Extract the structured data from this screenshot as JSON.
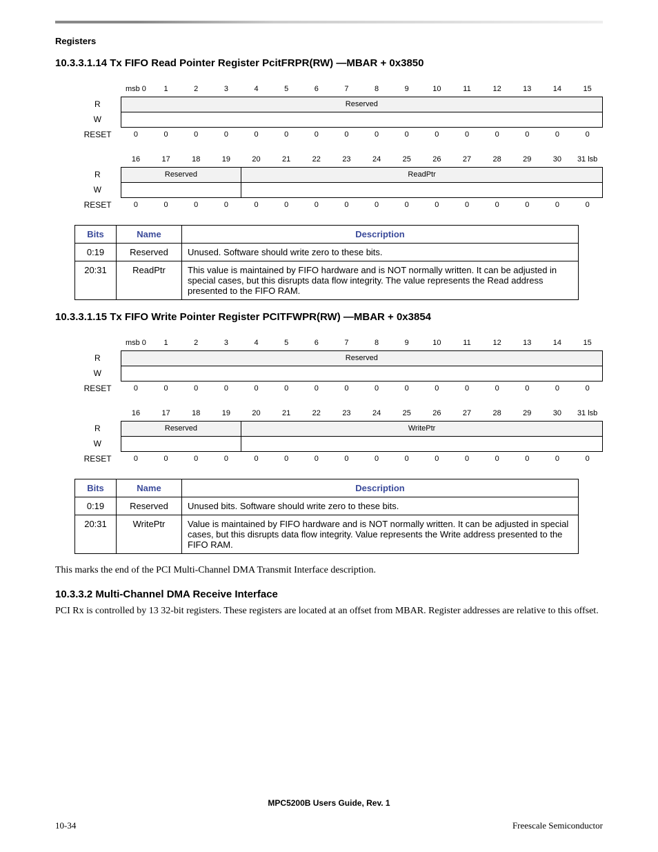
{
  "header_label": "Registers",
  "sec1": {
    "title": "10.3.3.1.14  Tx FIFO Read Pointer Register PcitFRPR(RW) —MBAR + 0x3850",
    "bits_hi": [
      "msb 0",
      "1",
      "2",
      "3",
      "4",
      "5",
      "6",
      "7",
      "8",
      "9",
      "10",
      "11",
      "12",
      "13",
      "14",
      "15"
    ],
    "bits_lo": [
      "16",
      "17",
      "18",
      "19",
      "20",
      "21",
      "22",
      "23",
      "24",
      "25",
      "26",
      "27",
      "28",
      "29",
      "30",
      "31 lsb"
    ],
    "rw_r": "R",
    "rw_w": "W",
    "rw_reset": "RESET",
    "row1_field": "Reserved",
    "row1_reset": [
      "0",
      "0",
      "0",
      "0",
      "0",
      "0",
      "0",
      "0",
      "0",
      "0",
      "0",
      "0",
      "0",
      "0",
      "0",
      "0"
    ],
    "row2_field1": "Reserved",
    "row2_field2": "ReadPtr",
    "row2_reset": [
      "0",
      "0",
      "0",
      "0",
      "0",
      "0",
      "0",
      "0",
      "0",
      "0",
      "0",
      "0",
      "0",
      "0",
      "0",
      "0"
    ],
    "desc_headers": {
      "bits": "Bits",
      "name": "Name",
      "desc": "Description"
    },
    "desc_rows": [
      {
        "bits": "0:19",
        "name": "Reserved",
        "desc": "Unused. Software should write zero to these bits."
      },
      {
        "bits": "20:31",
        "name": "ReadPtr",
        "desc": "This value is maintained by FIFO hardware and is NOT normally written. It can be adjusted in special cases, but this disrupts data flow integrity. The value represents the Read address presented to the FIFO RAM."
      }
    ]
  },
  "sec2": {
    "title": "10.3.3.1.15  Tx FIFO Write Pointer Register PCITFWPR(RW) —MBAR + 0x3854",
    "bits_hi": [
      "msb 0",
      "1",
      "2",
      "3",
      "4",
      "5",
      "6",
      "7",
      "8",
      "9",
      "10",
      "11",
      "12",
      "13",
      "14",
      "15"
    ],
    "bits_lo": [
      "16",
      "17",
      "18",
      "19",
      "20",
      "21",
      "22",
      "23",
      "24",
      "25",
      "26",
      "27",
      "28",
      "29",
      "30",
      "31 lsb"
    ],
    "row1_field": "Reserved",
    "row1_reset": [
      "0",
      "0",
      "0",
      "0",
      "0",
      "0",
      "0",
      "0",
      "0",
      "0",
      "0",
      "0",
      "0",
      "0",
      "0",
      "0"
    ],
    "row2_field1": "Reserved",
    "row2_field2": "WritePtr",
    "row2_reset": [
      "0",
      "0",
      "0",
      "0",
      "0",
      "0",
      "0",
      "0",
      "0",
      "0",
      "0",
      "0",
      "0",
      "0",
      "0",
      "0"
    ],
    "desc_rows": [
      {
        "bits": "0:19",
        "name": "Reserved",
        "desc": "Unused bits. Software should write zero to these bits."
      },
      {
        "bits": "20:31",
        "name": "WritePtr",
        "desc": "Value is maintained by FIFO hardware and is NOT normally written. It can be adjusted in special cases, but this disrupts data flow integrity. Value represents the Write address presented to the FIFO RAM."
      }
    ]
  },
  "closing_text": "This marks the end of the PCI Multi-Channel DMA Transmit Interface description.",
  "sec3": {
    "title": "10.3.3.2      Multi-Channel DMA Receive Interface",
    "body": "PCI Rx is controlled by 13 32-bit registers. These registers are located at an offset from MBAR. Register addresses are relative to this offset."
  },
  "footer": {
    "center": "MPC5200B Users Guide, Rev. 1",
    "left": "10-34",
    "right": "Freescale Semiconductor"
  }
}
